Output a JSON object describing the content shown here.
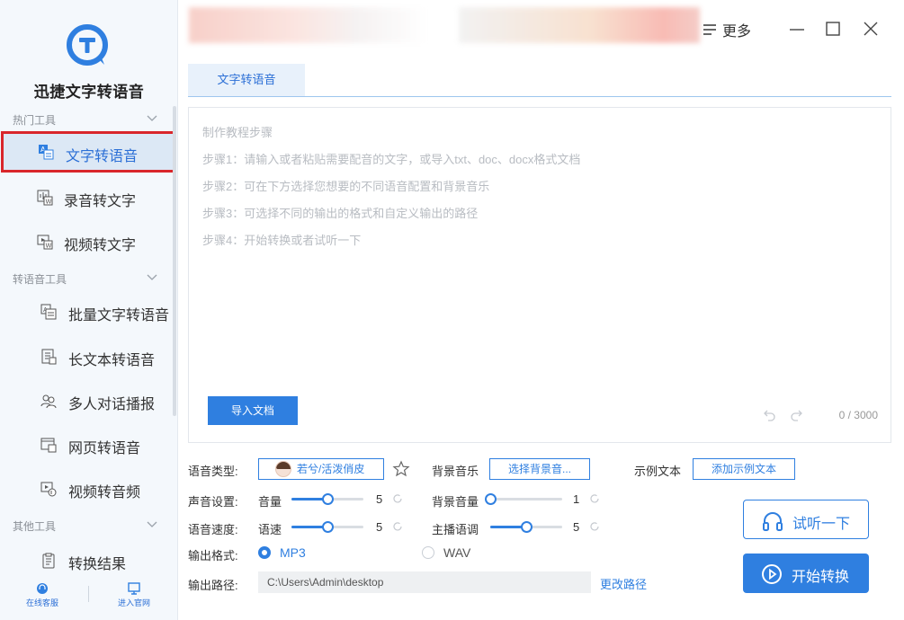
{
  "app": {
    "name": "迅捷文字转语音"
  },
  "sidebar": {
    "sections": [
      {
        "label": "热门工具"
      },
      {
        "label": "转语音工具"
      },
      {
        "label": "其他工具"
      }
    ],
    "items": [
      {
        "label": "文字转语音",
        "icon": "text-to-speech-icon",
        "active": true
      },
      {
        "label": "录音转文字",
        "icon": "audio-to-text-icon"
      },
      {
        "label": "视频转文字",
        "icon": "video-to-text-icon"
      },
      {
        "label": "批量文字转语音",
        "icon": "batch-tts-icon"
      },
      {
        "label": "长文本转语音",
        "icon": "long-text-icon"
      },
      {
        "label": "多人对话播报",
        "icon": "dialogue-icon"
      },
      {
        "label": "网页转语音",
        "icon": "webpage-icon"
      },
      {
        "label": "视频转音频",
        "icon": "video-to-audio-icon"
      },
      {
        "label": "转换结果",
        "icon": "results-icon"
      }
    ],
    "footer": {
      "support": "在线客服",
      "website": "进入官网"
    }
  },
  "titlebar": {
    "more": "更多"
  },
  "tabs": [
    {
      "label": "文字转语音",
      "active": true
    }
  ],
  "editor": {
    "guide_title": "制作教程步骤",
    "steps": [
      "步骤1：请输入或者粘贴需要配音的文字，或导入txt、doc、docx格式文档",
      "步骤2：可在下方选择您想要的不同语音配置和背景音乐",
      "步骤3：可选择不同的输出的格式和自定义输出的路径",
      "步骤4：开始转换或者试听一下"
    ],
    "import_button": "导入文档",
    "counter": "0 / 3000"
  },
  "settings": {
    "voice_type_label": "语音类型:",
    "voice_name": "若兮/活泼俏皮",
    "bgm_label": "背景音乐",
    "bgm_button": "选择背景音...",
    "sample_label": "示例文本",
    "sample_button": "添加示例文本",
    "sound_label": "声音设置:",
    "volume_label": "音量",
    "volume_value": "5",
    "volume_level": 0.5,
    "bgm_volume_label": "背景音量",
    "bgm_volume_value": "1",
    "bgm_volume_level": 0.0,
    "speed_label": "语音速度:",
    "speed_sub_label": "语速",
    "speed_value": "5",
    "speed_level": 0.5,
    "tone_label": "主播语调",
    "tone_value": "5",
    "tone_level": 0.5,
    "format_label": "输出格式:",
    "format_mp3": "MP3",
    "format_wav": "WAV",
    "selected_format": "MP3",
    "path_label": "输出路径:",
    "path_value": "C:\\Users\\Admin\\desktop",
    "change_path": "更改路径"
  },
  "actions": {
    "listen": "试听一下",
    "start": "开始转换"
  },
  "colors": {
    "accent": "#2f7fe0",
    "active_nav_bg": "#dce8f5",
    "highlight_border": "#d9262b"
  }
}
